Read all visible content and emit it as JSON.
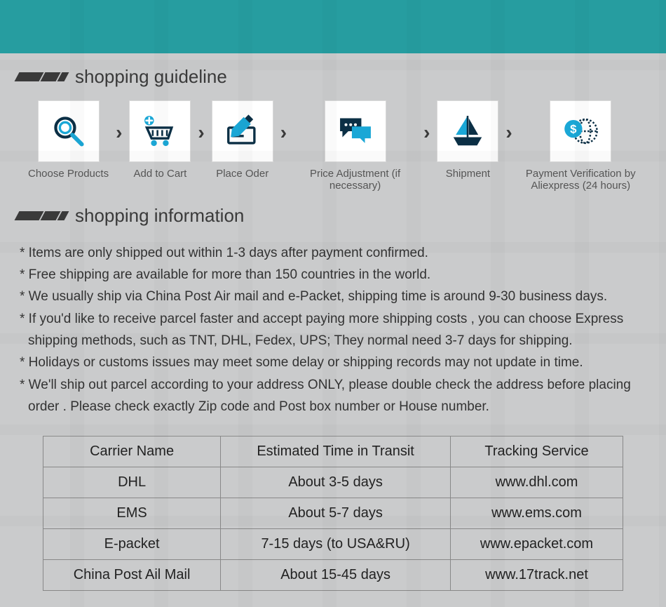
{
  "headings": {
    "guideline": "shopping guideline",
    "information": "shopping information"
  },
  "steps": [
    {
      "label": "Choose Products"
    },
    {
      "label": "Add to Cart"
    },
    {
      "label": "Place Oder"
    },
    {
      "label": "Price Adjustment (if necessary)"
    },
    {
      "label": "Shipment"
    },
    {
      "label": "Payment Verification by  Aliexpress (24 hours)"
    }
  ],
  "info_lines": [
    "* Items are only shipped out within 1-3 days after payment confirmed.",
    "* Free shipping are available for more than 150 countries in the world.",
    "* We usually ship via China Post Air mail and e-Packet, shipping time is around 9-30 business days.",
    "* If you'd like to receive parcel faster and accept paying more shipping costs , you can choose Express shipping methods, such as TNT, DHL, Fedex, UPS; They normal need 3-7 days for shipping.",
    "* Holidays or customs issues may meet some delay or shipping records may not update in time.",
    "* We'll ship out parcel according to your address ONLY, please double check the address before placing order . Please check exactly Zip code and Post box number or House number."
  ],
  "table": {
    "headers": [
      "Carrier Name",
      "Estimated Time in Transit",
      "Tracking Service"
    ],
    "rows": [
      [
        "DHL",
        "About 3-5 days",
        "www.dhl.com"
      ],
      [
        "EMS",
        "About 5-7 days",
        "www.ems.com"
      ],
      [
        "E-packet",
        "7-15 days (to USA&RU)",
        "www.epacket.com"
      ],
      [
        "China Post Ail Mail",
        "About 15-45 days",
        "www.17track.net"
      ]
    ]
  }
}
